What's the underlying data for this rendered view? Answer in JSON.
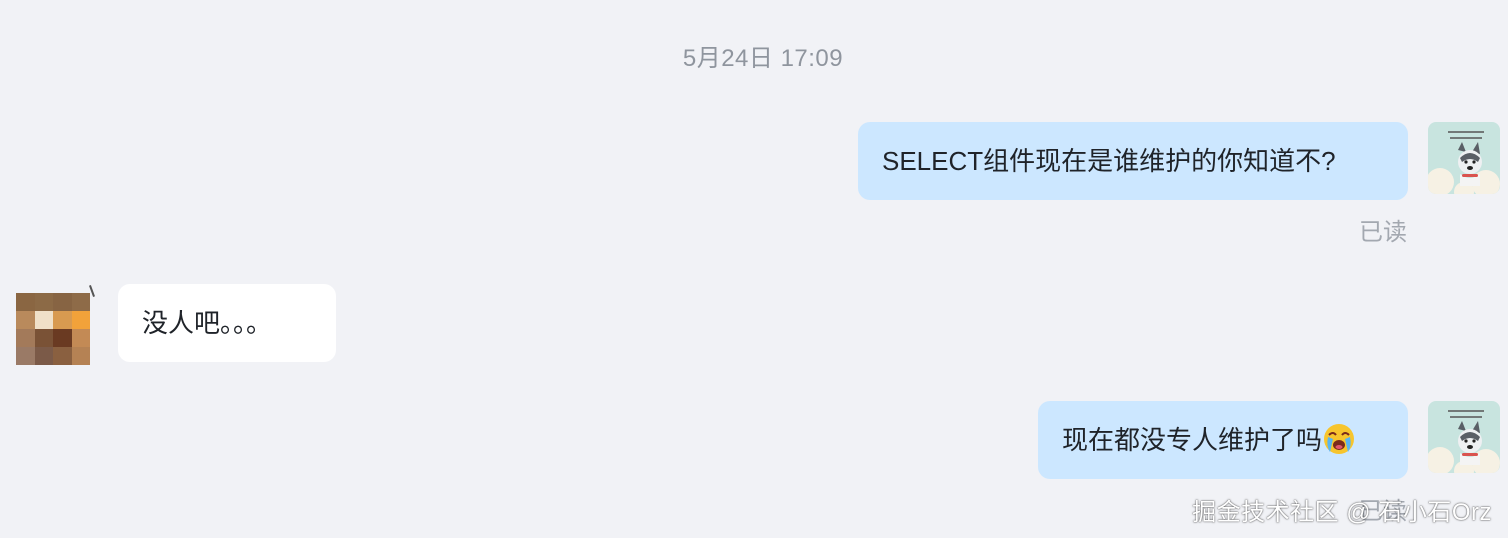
{
  "timestamp": "5月24日 17:09",
  "messages": [
    {
      "direction": "out",
      "text": "SELECT组件现在是谁维护的你知道不?",
      "status": "已读"
    },
    {
      "direction": "in",
      "text": "没人吧。。。"
    },
    {
      "direction": "out",
      "text": "现在都没专人维护了吗",
      "emoji": "crying-face-emoji",
      "status": "已读"
    }
  ],
  "watermark": "掘金技术社区 @ 石小石Orz",
  "colors": {
    "background": "#f1f2f6",
    "outgoing_bubble": "#cce7ff",
    "incoming_bubble": "#ffffff",
    "muted_text": "#8f959e"
  }
}
